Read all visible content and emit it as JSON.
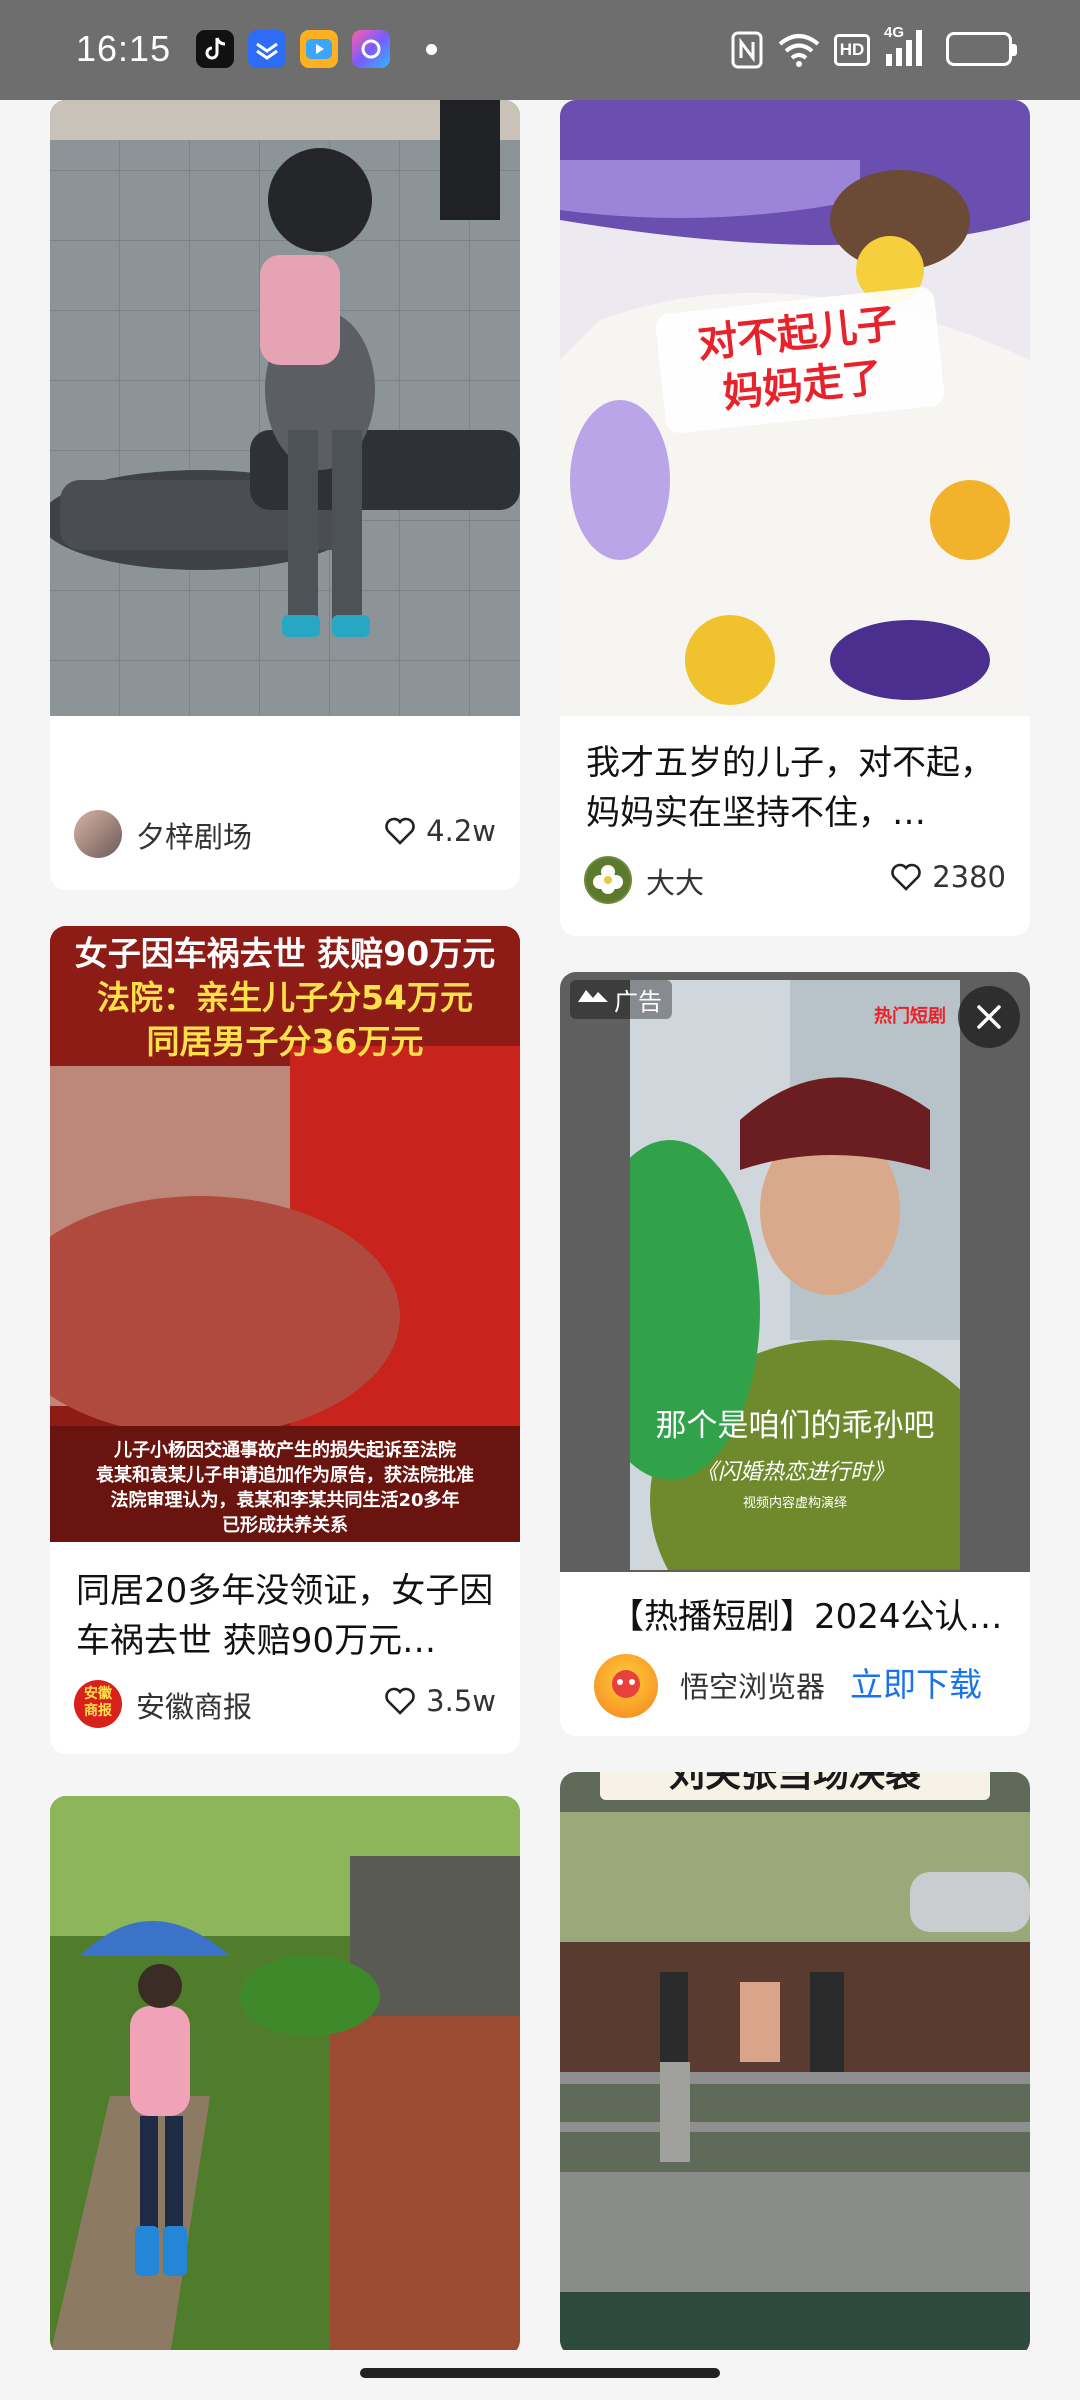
{
  "status_bar": {
    "time": "16:15",
    "icons": [
      "tiktok-icon",
      "blue-arrow-app-icon",
      "video-app-icon",
      "gallery-app-icon",
      "nfc-icon",
      "wifi-icon",
      "hd-icon",
      "signal-4g-icon",
      "battery-icon"
    ],
    "hd_label": "HD",
    "network_label": "4G"
  },
  "feed": {
    "cards": [
      {
        "title": "",
        "author": "夕梓剧场",
        "likes": "4.2w",
        "avatar_icon": "author-avatar-icon"
      },
      {
        "overlay": [
          "对不起儿子",
          "妈妈走了"
        ],
        "title": "我才五岁的儿子，对不起，妈妈实在坚持不住，…",
        "author": "大大",
        "likes": "2380",
        "avatar_icon": "flower-avatar-icon"
      },
      {
        "overlay": [
          "女子因车祸去世 获赔90万元",
          "法院：亲生儿子分54万元",
          "同居男子分36万元"
        ],
        "caption": [
          "儿子小杨因交通事故产生的损失起诉至法院",
          "袁某和袁某儿子申请追加作为原告，获法院批准",
          "法院审理认为，袁某和李某共同生活20多年",
          "已形成扶养关系"
        ],
        "title": "同居20多年没领证，女子因车祸去世 获赔90万元…",
        "author": "安徽商报",
        "author_badge": "安徽商报",
        "likes": "3.5w"
      },
      {
        "ad_label": "广告",
        "video_badge": "热门短剧",
        "video_caption": "那个是咱们的乖孙吧",
        "video_subtitle": "《闪婚热恋进行时》",
        "video_note": "视频内容虚构演绎",
        "title": "【热播短剧】2024公认…",
        "author": "悟空浏览器",
        "download_label": "立即下载"
      },
      {
        "title": "",
        "author": "",
        "likes": ""
      },
      {
        "overlay": [
          "刘关张当场决裂"
        ],
        "title": "",
        "author": "",
        "likes": ""
      }
    ]
  },
  "colors": {
    "status_bar_bg": "#6e6e6e",
    "feed_bg": "#f5f5f5",
    "card_bg": "#ffffff",
    "link_blue": "#1a73e8",
    "battery": "#f2b230"
  }
}
